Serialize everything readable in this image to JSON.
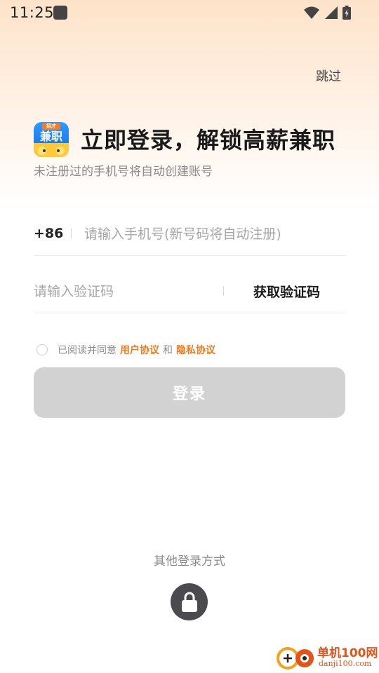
{
  "status_bar": {
    "time": "11:25",
    "icons": [
      "notification-icon",
      "wifi-icon",
      "signal-icon",
      "battery-icon"
    ]
  },
  "header": {
    "skip_label": "跳过",
    "logo_text": "兼职",
    "logo_badge": "招才",
    "title": "立即登录，解锁高薪兼职",
    "subtitle": "未注册过的手机号将自动创建账号"
  },
  "form": {
    "country_code": "+86",
    "phone_placeholder": "请输入手机号(新号码将自动注册)",
    "phone_value": "",
    "code_placeholder": "请输入验证码",
    "code_value": "",
    "get_code_label": "获取验证码"
  },
  "agreement": {
    "prefix": "已阅读并同意",
    "user_agreement": "用户协议",
    "conjunction": "和",
    "privacy_policy": "隐私协议",
    "checked": false
  },
  "login_button_label": "登录",
  "other_login": {
    "title": "其他登录方式",
    "method_icon": "lock-icon"
  },
  "watermark": {
    "name": "单机100网",
    "domain": "danji100.com"
  },
  "colors": {
    "accent": "#f27a1a",
    "button_disabled": "#d2d2d2",
    "header_gradient": "#fde3c9",
    "lock_button": "#4a4a4f"
  }
}
